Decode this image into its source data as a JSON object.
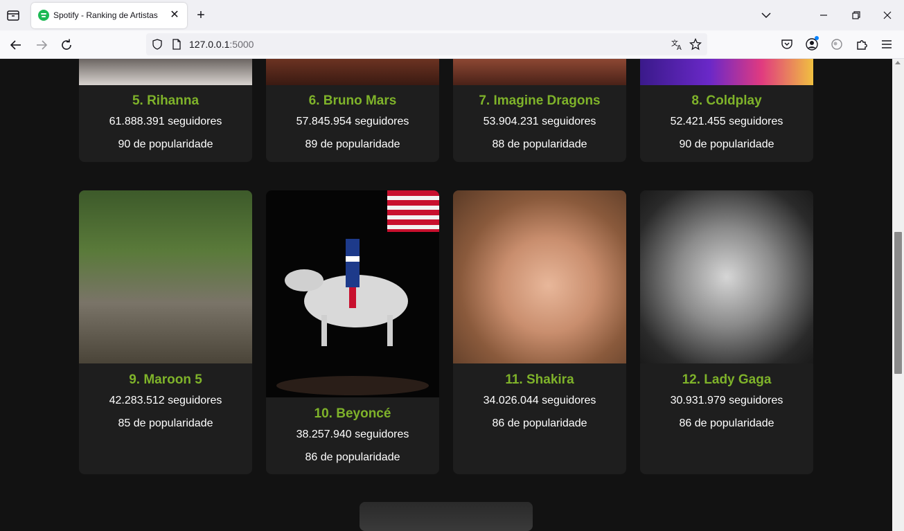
{
  "browser": {
    "tab_title": "Spotify - Ranking de Artistas",
    "url_host": "127.0.0.1",
    "url_port": ":5000"
  },
  "artists": [
    {
      "name": "5. Rihanna",
      "followers": "61.888.391 seguidores",
      "popularity": "90 de popularidade"
    },
    {
      "name": "6. Bruno Mars",
      "followers": "57.845.954 seguidores",
      "popularity": "89 de popularidade"
    },
    {
      "name": "7. Imagine Dragons",
      "followers": "53.904.231 seguidores",
      "popularity": "88 de popularidade"
    },
    {
      "name": "8. Coldplay",
      "followers": "52.421.455 seguidores",
      "popularity": "90 de popularidade"
    },
    {
      "name": "9. Maroon 5",
      "followers": "42.283.512 seguidores",
      "popularity": "85 de popularidade"
    },
    {
      "name": "10. Beyoncé",
      "followers": "38.257.940 seguidores",
      "popularity": "86 de popularidade"
    },
    {
      "name": "11. Shakira",
      "followers": "34.026.044 seguidores",
      "popularity": "86 de popularidade"
    },
    {
      "name": "12. Lady Gaga",
      "followers": "30.931.979 seguidores",
      "popularity": "86 de popularidade"
    }
  ],
  "colors": {
    "accent": "#7fb32a",
    "card_bg": "#1e1e1e",
    "page_bg": "#121212"
  }
}
